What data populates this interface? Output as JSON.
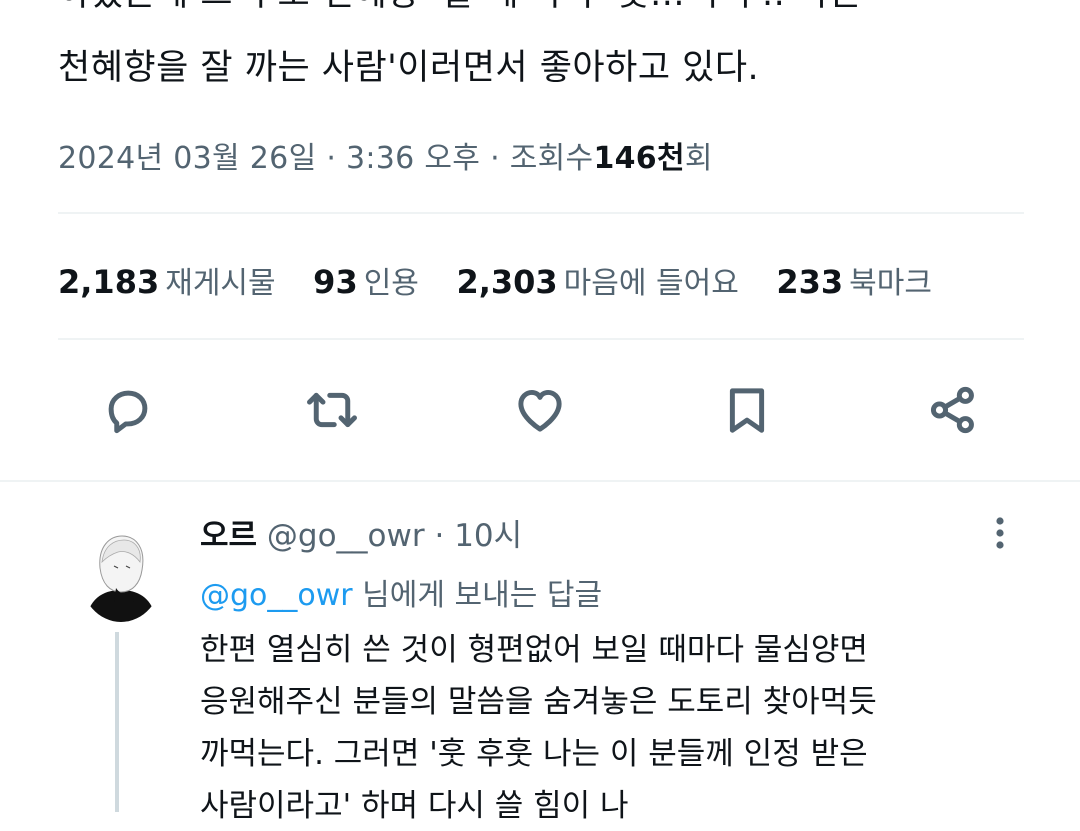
{
  "tweet": {
    "text_lines": [
      "하겠는데 그 후로 천혜향 '잘 때 마다' 훗... 후후.. 나는",
      "천혜향을 잘 까는 사람'이러면서 좋아하고 있다."
    ],
    "date": "2024년 03월 26일",
    "time": "3:36 오후",
    "views_label": "조회수",
    "views_number": "146천",
    "views_suffix": "회",
    "separator": "·"
  },
  "stats": {
    "retweets": {
      "count": "2,183",
      "label": "재게시물"
    },
    "quotes": {
      "count": "93",
      "label": "인용"
    },
    "likes": {
      "count": "2,303",
      "label": "마음에 들어요"
    },
    "bookmarks": {
      "count": "233",
      "label": "북마크"
    }
  },
  "actions": [
    {
      "icon": "reply-icon"
    },
    {
      "icon": "retweet-icon"
    },
    {
      "icon": "like-icon"
    },
    {
      "icon": "bookmark-icon"
    },
    {
      "icon": "share-icon"
    }
  ],
  "reply": {
    "name": "오르",
    "handle": "@go__owr",
    "separator": "·",
    "time": "10시",
    "replying_mention": "@go__owr",
    "replying_suffix": "님에게 보내는 답글",
    "text_lines": [
      "한편 열심히 쓴 것이 형편없어 보일 때마다 물심양면",
      "응원해주신 분들의 말씀을 숨겨놓은 도토리 찾아먹듯",
      "까먹는다. 그러면 '훗 후훗 나는 이 분들께 인정 받은",
      "사람이라고' 하며 다시 쓸 힘이 나"
    ]
  },
  "colors": {
    "text": "#0f1419",
    "secondary": "#536471",
    "accent": "#1d9bf0",
    "divider": "#eff3f4"
  }
}
